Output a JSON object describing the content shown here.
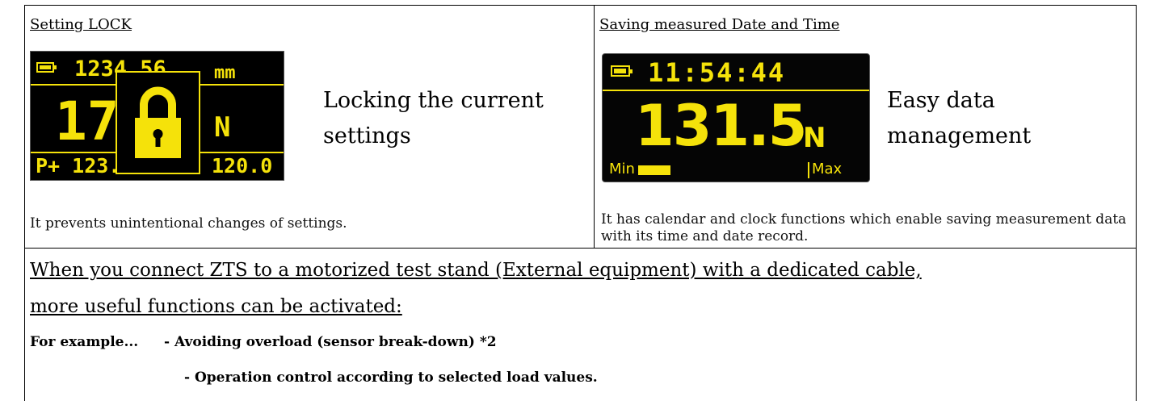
{
  "left_panel": {
    "title": "Setting LOCK",
    "display": {
      "top_value": "1234.56",
      "top_unit": "mm",
      "main_value": "17",
      "main_unit": "N",
      "bottom_left": "P+ 123.4",
      "bottom_right": "120.0",
      "lock_symbol": "lock-icon"
    },
    "caption": "Locking the current settings",
    "description": "It prevents unintentional changes of settings."
  },
  "right_panel": {
    "title": "Saving measured Date and Time",
    "display": {
      "time": "11:54:44",
      "main_value": "131.5",
      "main_unit": "N",
      "min_label": "Min",
      "max_label": "Max",
      "bar_fill": 0.2
    },
    "caption": "Easy data management",
    "description": "It has calendar and clock functions which enable saving measurement data with its time and date record."
  },
  "banner": {
    "line1": "When you connect ZTS to a motorized test stand (External equipment) with a dedicated cable,",
    "line2": "more useful functions can be activated:"
  },
  "examples": {
    "lead": "For example...",
    "item1": "- Avoiding overload (sensor break-down) *2",
    "item2": "- Operation control according to selected load values."
  },
  "colors": {
    "display_yellow": "#f5e20a",
    "display_background": "#000000"
  }
}
